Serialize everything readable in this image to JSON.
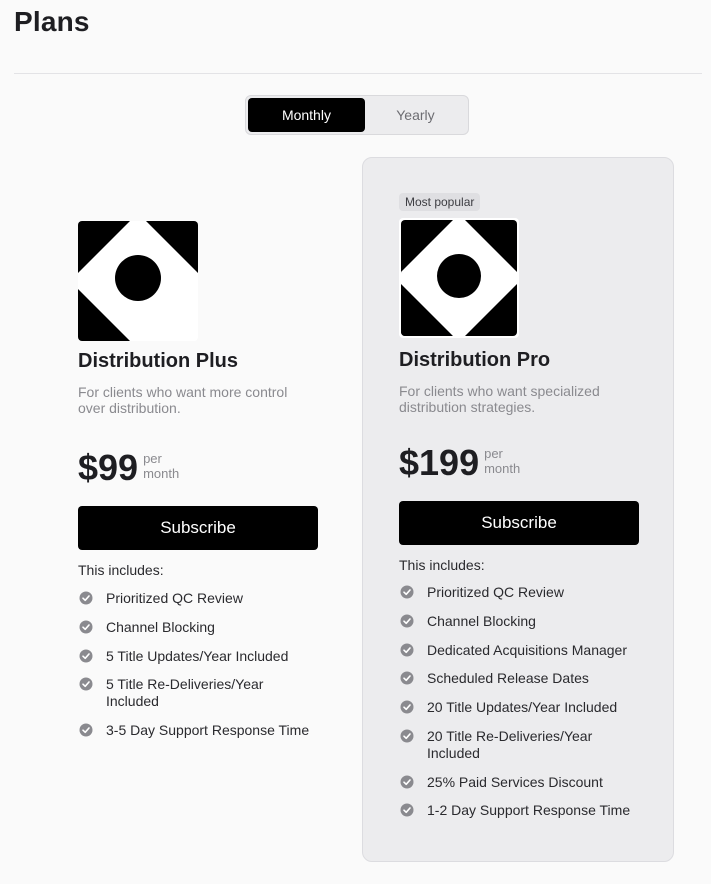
{
  "page": {
    "title": "Plans"
  },
  "billing_toggle": {
    "options": [
      {
        "label": "Monthly",
        "selected": true
      },
      {
        "label": "Yearly",
        "selected": false
      }
    ]
  },
  "plans": [
    {
      "name": "Distribution Plus",
      "description": "For clients who want more control over distribution.",
      "price": "$99",
      "per_line1": "per",
      "per_line2": "month",
      "button_label": "Subscribe",
      "includes_label": "This includes:",
      "features": [
        "Prioritized QC Review",
        "Channel Blocking",
        "5 Title Updates/Year Included",
        "5 Title Re-Deliveries/Year Included",
        "3-5 Day Support Response Time"
      ]
    },
    {
      "badge": "Most popular",
      "name": "Distribution Pro",
      "description": "For clients who want specialized distribution strategies.",
      "price": "$199",
      "per_line1": "per",
      "per_line2": "month",
      "button_label": "Subscribe",
      "includes_label": "This includes:",
      "features": [
        "Prioritized QC Review",
        "Channel Blocking",
        "Dedicated Acquisitions Manager",
        "Scheduled Release Dates",
        "20 Title Updates/Year Included",
        "20 Title Re-Deliveries/Year Included",
        "25% Paid Services Discount",
        "1-2 Day Support Response Time"
      ]
    }
  ],
  "colors": {
    "accent": "#000000",
    "check_icon": "#8a8a8f",
    "highlight_card_bg": "#ececee"
  },
  "icons": {
    "logo": "distribution-logo-icon",
    "check": "check-circle-icon"
  }
}
